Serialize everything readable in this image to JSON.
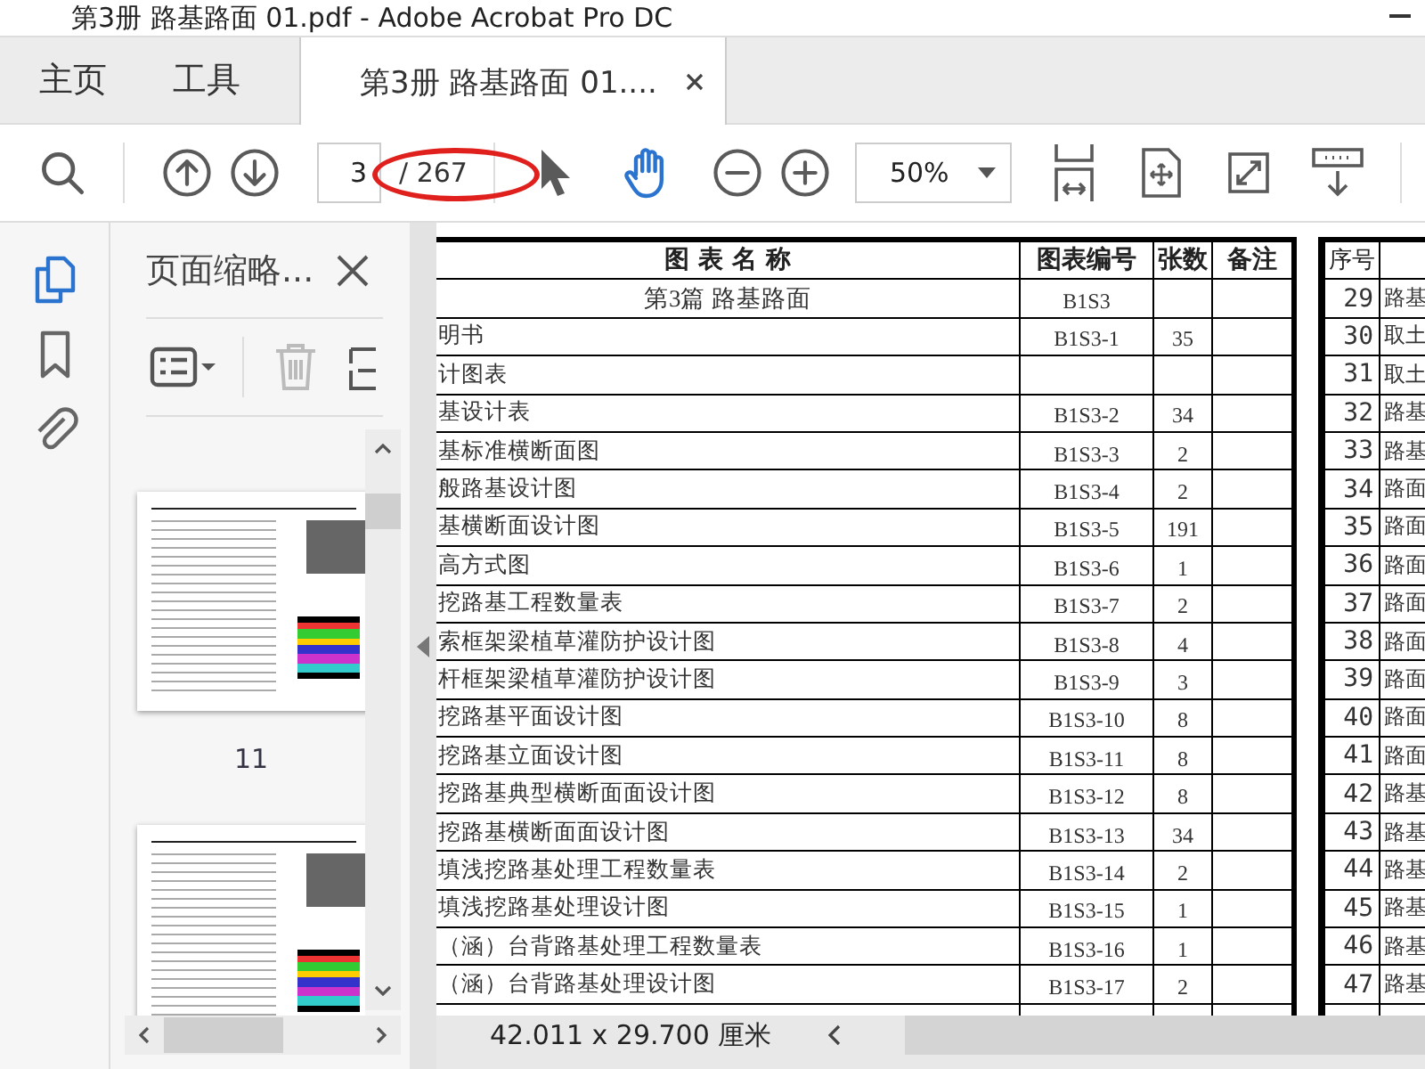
{
  "window": {
    "title": "第3册 路基路面 01.pdf - Adobe Acrobat Pro DC"
  },
  "tabs": [
    {
      "label": "主页",
      "selected": false,
      "kind": "menu"
    },
    {
      "label": "工具",
      "selected": false,
      "kind": "menu"
    },
    {
      "label": "第3册 路基路面 01....",
      "selected": true,
      "kind": "document"
    }
  ],
  "toolbar": {
    "page_number": "3",
    "page_count": "/ 267",
    "zoom": "50%",
    "tools": [
      {
        "selected": false
      },
      {
        "selected": true
      }
    ]
  },
  "sidebar": {
    "tabs": [
      {
        "selected": true
      },
      {
        "selected": false
      },
      {
        "selected": false
      }
    ],
    "panel": {
      "title": "页面缩略...",
      "delete_disabled": true,
      "thumbnails": [
        {
          "page_label": "11"
        }
      ]
    }
  },
  "document": {
    "index_table": {
      "columns": [
        "图 表 名 称",
        "图表编号",
        "张数",
        "备注"
      ],
      "rows": [
        {
          "name": "第3篇  路基路面",
          "code": "B1S3",
          "count": ""
        },
        {
          "name": "明书",
          "code": "B1S3-1",
          "count": "35"
        },
        {
          "name": "计图表",
          "code": "",
          "count": ""
        },
        {
          "name": "基设计表",
          "code": "B1S3-2",
          "count": "34"
        },
        {
          "name": "基标准横断面图",
          "code": "B1S3-3",
          "count": "2"
        },
        {
          "name": "般路基设计图",
          "code": "B1S3-4",
          "count": "2"
        },
        {
          "name": "基横断面设计图",
          "code": "B1S3-5",
          "count": "191"
        },
        {
          "name": "高方式图",
          "code": "B1S3-6",
          "count": "1"
        },
        {
          "name": "挖路基工程数量表",
          "code": "B1S3-7",
          "count": "2"
        },
        {
          "name": "索框架梁植草灌防护设计图",
          "code": "B1S3-8",
          "count": "4"
        },
        {
          "name": "杆框架梁植草灌防护设计图",
          "code": "B1S3-9",
          "count": "3"
        },
        {
          "name": "挖路基平面设计图",
          "code": "B1S3-10",
          "count": "8"
        },
        {
          "name": "挖路基立面设计图",
          "code": "B1S3-11",
          "count": "8"
        },
        {
          "name": "挖路基典型横断面面设计图",
          "code": "B1S3-12",
          "count": "8"
        },
        {
          "name": "挖路基横断面面设计图",
          "code": "B1S3-13",
          "count": "34"
        },
        {
          "name": "填浅挖路基处理工程数量表",
          "code": "B1S3-14",
          "count": "2"
        },
        {
          "name": "填浅挖路基处理设计图",
          "code": "B1S3-15",
          "count": "1"
        },
        {
          "name": "（涵）台背路基处理工程数量表",
          "code": "B1S3-16",
          "count": "1"
        },
        {
          "name": "（涵）台背路基处理设计图",
          "code": "B1S3-17",
          "count": "2"
        }
      ]
    },
    "side_table": {
      "columns": [
        "序号"
      ],
      "rows": [
        {
          "number": "29",
          "name": "路基"
        },
        {
          "number": "30",
          "name": "取土"
        },
        {
          "number": "31",
          "name": "取土"
        },
        {
          "number": "32",
          "name": "路基"
        },
        {
          "number": "33",
          "name": "路基"
        },
        {
          "number": "34",
          "name": "路面"
        },
        {
          "number": "35",
          "name": "路面"
        },
        {
          "number": "36",
          "name": "路面"
        },
        {
          "number": "37",
          "name": "路面"
        },
        {
          "number": "38",
          "name": "路面"
        },
        {
          "number": "39",
          "name": "路面"
        },
        {
          "number": "40",
          "name": "路面"
        },
        {
          "number": "41",
          "name": "路面"
        },
        {
          "number": "42",
          "name": "路基"
        },
        {
          "number": "43",
          "name": "路基"
        },
        {
          "number": "44",
          "name": "路基"
        },
        {
          "number": "45",
          "name": "路基"
        },
        {
          "number": "46",
          "name": "路基"
        },
        {
          "number": "47",
          "name": "路基"
        }
      ]
    }
  },
  "status_bar": {
    "page_size": "42.011 x 29.700 厘米"
  }
}
